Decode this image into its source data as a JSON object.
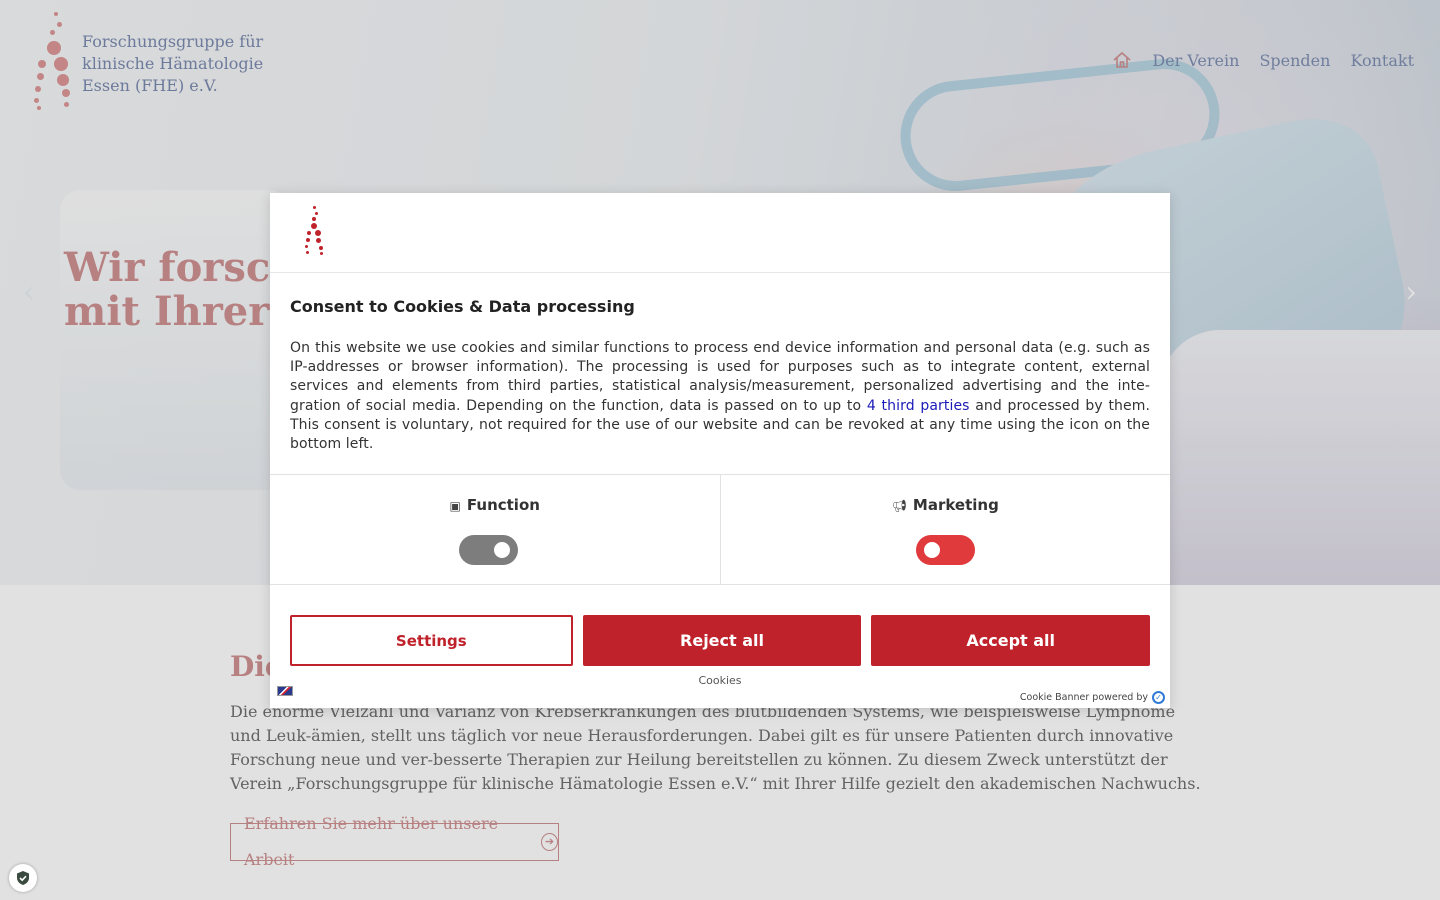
{
  "site": {
    "logo_lines": [
      "Forschungsgruppe für",
      "klinische Hämatologie",
      "Essen (FHE) e.V."
    ],
    "nav": {
      "home_icon": "home-icon",
      "items": [
        "Der Verein",
        "Spenden",
        "Kontakt"
      ]
    },
    "hero": {
      "heading_lines": [
        "Wir forsche",
        "mit Ihrer U"
      ]
    },
    "carousel": {
      "prev_icon": "chevron-left-icon",
      "next_icon": "chevron-right-icon"
    },
    "section": {
      "heading": "Die",
      "paragraph": "Die enorme Vielzahl und Varianz von Krebserkrankungen des blutbildenden Systems, wie beispielsweise Lymphome und Leuk-ämien, stellt uns täglich vor neue Herausforderungen. Dabei gilt es für unsere Patienten durch innovative Forschung neue und ver-besserte Therapien zur Heilung bereitstellen zu können. Zu diesem Zweck unterstützt der Verein „Forschungsgruppe für klinische Hämatologie Essen e.V.“ mit Ihrer Hilfe gezielt den akademischen Nachwuchs.",
      "cta_label": "Erfahren Sie mehr über unsere Arbeit"
    },
    "colors": {
      "brand": "#c98384",
      "nav": "#6f80a8",
      "consent_red": "#c0222b"
    }
  },
  "consent": {
    "title": "Consent to Cookies & Data processing",
    "text_before_link": "On this website we use cookies and similar functions to process end device information and personal data (e.g. such as IP-addresses or browser information). The processing is used for purposes such as to integrate content, external services and elements from third parties, statistical analysis/measurement, personalized advertising and the inte-gration of social media. Depending on the function, data is passed on to up to ",
    "link_text": "4 third parties",
    "text_after_link": " and processed by them. This consent is voluntary, not required for the use of our website and can be revoked at any time using the icon on the bottom left.",
    "toggles": [
      {
        "label": "Function",
        "icon": "function-icon",
        "enabled": true
      },
      {
        "label": "Marketing",
        "icon": "megaphone-icon",
        "enabled": false
      }
    ],
    "buttons": {
      "settings": "Settings",
      "reject": "Reject all",
      "accept": "Accept all"
    },
    "cookies_link": "Cookies",
    "powered_by": "Cookie Banner powered by"
  }
}
